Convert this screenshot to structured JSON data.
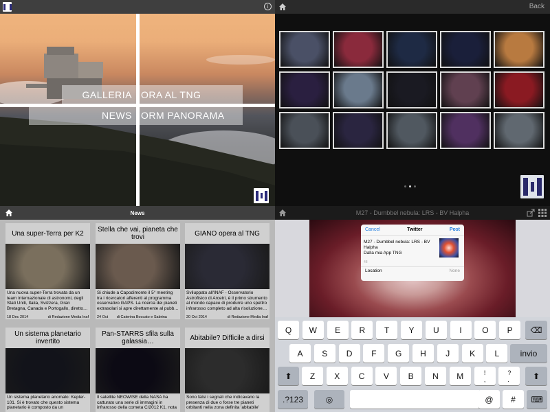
{
  "q1": {
    "menu": {
      "galleria": "GALLERIA",
      "ora_al_tng": "ORA AL TNG",
      "news": "NEWS",
      "orm_panorama": "ORM PANORAMA"
    },
    "info_icon": "i"
  },
  "q2": {
    "back_label": "Back",
    "gallery_thumbs": [
      {
        "name": "telescope-dome-wide",
        "color": "#4a5066"
      },
      {
        "name": "pillars-nebula",
        "color": "#8a2a3c"
      },
      {
        "name": "dome-night",
        "color": "#1e2a44"
      },
      {
        "name": "spiral-galaxy-blue",
        "color": "#1a1f3a"
      },
      {
        "name": "tng-sunset",
        "color": "#b87a40"
      },
      {
        "name": "edge-galaxy",
        "color": "#2a1f40"
      },
      {
        "name": "observatory-sky",
        "color": "#6a7a8c"
      },
      {
        "name": "galaxy-group",
        "color": "#1a1a22"
      },
      {
        "name": "dome-dusk",
        "color": "#604050"
      },
      {
        "name": "red-nebula-bubble",
        "color": "#8a1a22"
      },
      {
        "name": "control-room",
        "color": "#4a5058"
      },
      {
        "name": "spiral-galaxy-pink",
        "color": "#2a2540"
      },
      {
        "name": "instrument-lab",
        "color": "#505860"
      },
      {
        "name": "crab-nebula",
        "color": "#503060"
      },
      {
        "name": "telescope-interior",
        "color": "#606870"
      }
    ],
    "page_dots": 3,
    "active_dot": 1
  },
  "q3": {
    "title": "News",
    "cards": [
      {
        "title": "Una super-Terra per K2",
        "text": "Una nuova super-Terra trovata da un team internazionale di astronomi, degli Stati Uniti, Italia, Svizzera, Gran Bretagna, Canada e Portogallo, diretto…",
        "date": "18 Dec 2014",
        "author": "di Redazione Media Inaf",
        "img": "#7a6f5d"
      },
      {
        "title": "Stella che vai, pianeta che trovi",
        "text": "Si chiude a Capodimonte il 5° meeting tra i ricercatori afferenti al programma osservativo GAPS.  La ricerca dei pianeti extrasolari si apre direttamente al pubb…",
        "date": "24 Oct 2014",
        "author": "di Caterina Boccato e Sabrina Masiero",
        "img": "#6a5a4e"
      },
      {
        "title": "GIANO opera al TNG",
        "text": "Sviluppato all'INAF - Osservatorio Astrofisico di Arcetri, è il primo strumento al mondo capace di produrre uno spettro infrarosso completo ad alta risoluzione…",
        "date": "20 Oct 2014",
        "author": "di Redazione Media Inaf",
        "img": "#2a2a35"
      },
      {
        "title": "Un sistema planetario invertito",
        "text": "Un sistema planetario anomalo: Kepler-101. Si è trovato che questo sistema planetario è composto da un",
        "date": "",
        "author": "",
        "img": "#12131a"
      },
      {
        "title": "Pan-STARRS sfila sulla galassia…",
        "text": "Il satellite NEOWISE della NASA ha catturato una serie di immagini in infrarosso della cometa C/2012 K1, nota",
        "date": "",
        "author": "",
        "img": "#0c0a14"
      },
      {
        "title": "Abitabile? Difficile a dirsi",
        "text": "Sono falsi i segnali che indicavano la presenza di due o forse tre pianeti orbitanti nella zona definita 'abitabile'",
        "date": "",
        "author": "",
        "img": "#2c2c2c"
      }
    ]
  },
  "q4": {
    "title": "M27 - Dumbbel nebula: LRS - BV Halpha",
    "twitter": {
      "cancel": "Cancel",
      "title": "Twitter",
      "post": "Post",
      "text": "M27 - Dumbbel nebula: LRS - BV Halpha\nDalla mia App TNG",
      "count": "48",
      "location_label": "Location",
      "location_value": "None"
    },
    "keyboard": {
      "row1": [
        "Q",
        "W",
        "E",
        "R",
        "T",
        "Y",
        "U",
        "I",
        "O",
        "P"
      ],
      "row2": [
        "A",
        "S",
        "D",
        "F",
        "G",
        "H",
        "J",
        "K",
        "L"
      ],
      "row3": [
        "Z",
        "X",
        "C",
        "V",
        "B",
        "N",
        "M",
        "!\n,",
        "?\n."
      ],
      "return": "invio",
      "numbers": ".?123",
      "at": "@",
      "hash": "#"
    }
  }
}
